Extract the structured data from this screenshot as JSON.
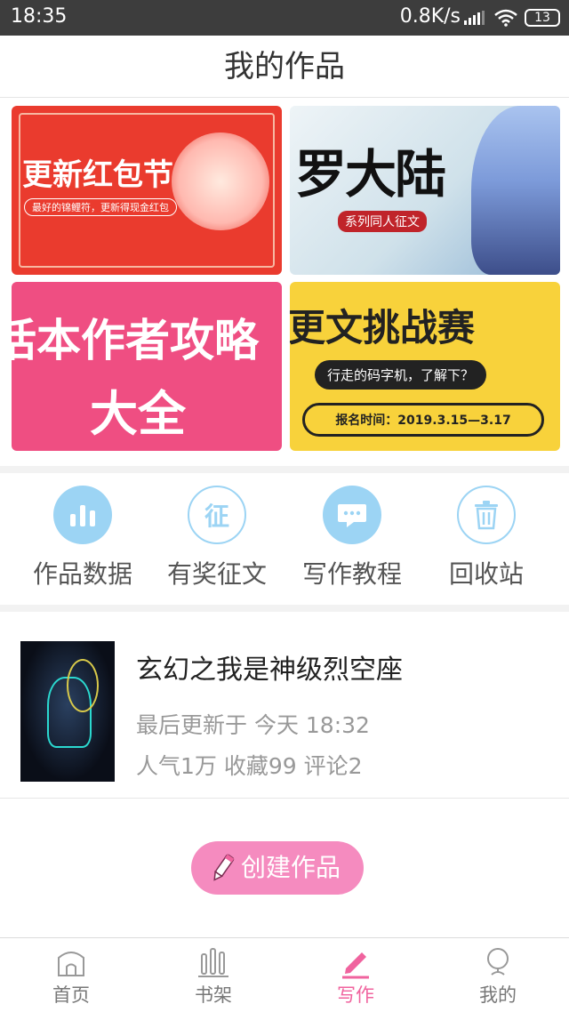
{
  "status_bar": {
    "time": "18:35",
    "network_speed": "0.8K/s",
    "battery": "13"
  },
  "header": {
    "title": "我的作品"
  },
  "banners": [
    {
      "id": "red-packet",
      "title": "更新红包节",
      "subtitle": "最好的锦鲤符，更新得现金红包"
    },
    {
      "id": "douluo",
      "title": "罗大陆",
      "subtitle": "系列同人征文"
    },
    {
      "id": "guide",
      "title_line1": "话本作者攻略",
      "title_line2": "大全"
    },
    {
      "id": "challenge",
      "title": "更文挑战赛",
      "pill": "行走的码字机，了解下？",
      "date": "报名时间：2019.3.15—3.17"
    }
  ],
  "quick_actions": [
    {
      "label": "作品数据",
      "icon": "bar-chart-icon"
    },
    {
      "label": "有奖征文",
      "icon": "zheng-icon",
      "icon_char": "征"
    },
    {
      "label": "写作教程",
      "icon": "chat-bubble-icon"
    },
    {
      "label": "回收站",
      "icon": "trash-icon"
    }
  ],
  "work": {
    "title": "玄幻之我是神级烈空座",
    "updated": "最后更新于 今天 18:32",
    "stats": "人气1万 收藏99 评论2"
  },
  "create_button": {
    "label": "创建作品"
  },
  "tabs": [
    {
      "label": "首页",
      "icon": "home-icon"
    },
    {
      "label": "书架",
      "icon": "bookshelf-icon"
    },
    {
      "label": "写作",
      "icon": "pen-icon",
      "active": true
    },
    {
      "label": "我的",
      "icon": "profile-icon"
    }
  ],
  "colors": {
    "accent": "#f0639e",
    "icon_blue": "#9cd4f4",
    "create_button": "#f58bbf"
  }
}
